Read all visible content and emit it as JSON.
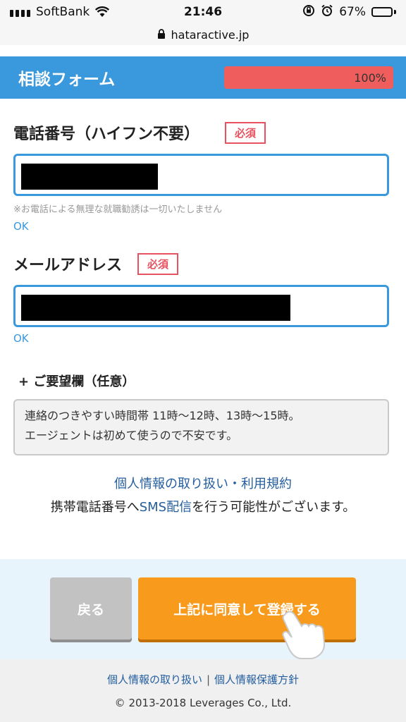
{
  "status_bar": {
    "carrier": "SoftBank",
    "time": "21:46",
    "battery_percent": "67%",
    "battery_level": 0.67,
    "icons": [
      "signal-icon",
      "wifi-icon",
      "rotation-lock-icon",
      "alarm-icon",
      "battery-icon"
    ]
  },
  "url_bar": {
    "domain": "hataractive.jp",
    "icon": "lock-icon"
  },
  "header": {
    "title": "相談フォーム",
    "progress_text": "100%",
    "progress_value": 1.0
  },
  "phone_field": {
    "label": "電話番号（ハイフン不要）",
    "required_badge": "必須",
    "hint": "※お電話による無理な就職勧誘は一切いたしません",
    "status": "OK"
  },
  "email_field": {
    "label": "メールアドレス",
    "required_badge": "必須",
    "status": "OK"
  },
  "remarks": {
    "label": "+ ご要望欄（任意）",
    "line1": "連絡のつきやすい時間帯 11時〜12時、13時〜15時。",
    "line2": "エージェントは初めて使うので不安です。"
  },
  "notice": {
    "policy_link": "個人情報の取り扱い・利用規約",
    "sms_before": "携帯電話番号へ",
    "sms_highlight": "SMS配信",
    "sms_after": "を行う可能性がございます。"
  },
  "actions": {
    "back_label": "戻る",
    "submit_label": "上記に同意して登録する"
  },
  "footer": {
    "link1": "個人情報の取り扱い",
    "separator": "|",
    "link2": "個人情報保護方針",
    "copyright": "© 2013-2018 Leverages Co., Ltd."
  },
  "colors": {
    "header_blue": "#3a98dd",
    "progress_red": "#ef5d5d",
    "required_red": "#e8515f",
    "submit_orange": "#f89a1c",
    "link_blue": "#245e9e"
  }
}
